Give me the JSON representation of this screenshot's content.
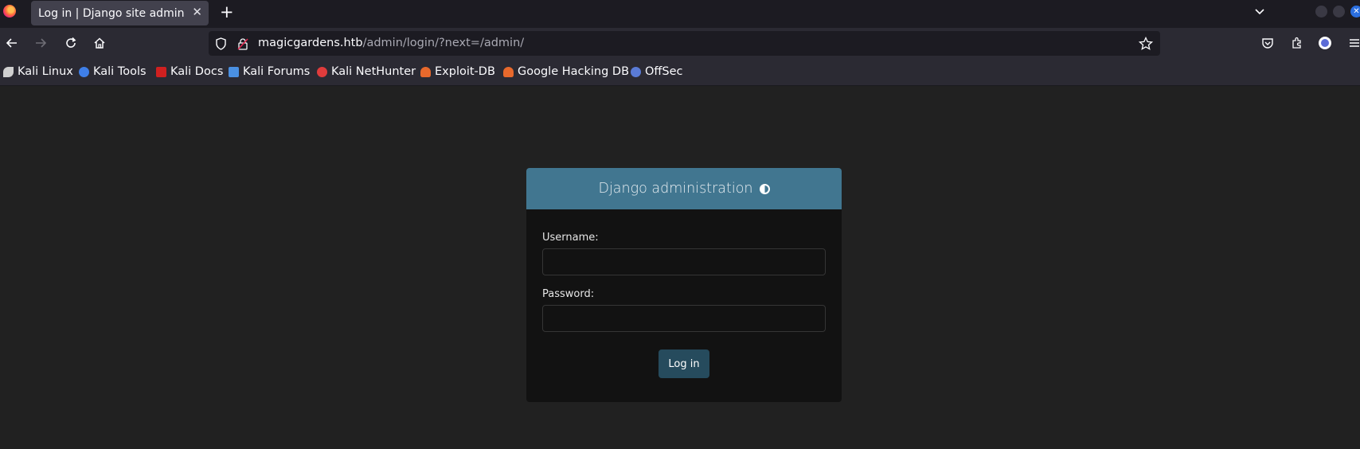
{
  "browser": {
    "tab": {
      "title": "Log in | Django site admin",
      "close_glyph": "✕"
    },
    "new_tab_glyph": "+",
    "tab_list_glyph": "⌄",
    "url": {
      "host": "magicgardens.htb",
      "path": "/admin/login/?next=/admin/"
    },
    "bookmarks": [
      {
        "label": "Kali Linux",
        "icon": "kali-dragon-icon",
        "color": "#d0d0d0"
      },
      {
        "label": "Kali Tools",
        "icon": "kali-tools-icon",
        "color": "#3f7fe8"
      },
      {
        "label": "Kali Docs",
        "icon": "kali-docs-icon",
        "color": "#d02020"
      },
      {
        "label": "Kali Forums",
        "icon": "kali-forums-icon",
        "color": "#4a90e2"
      },
      {
        "label": "Kali NetHunter",
        "icon": "kali-nethunter-icon",
        "color": "#e03c3c"
      },
      {
        "label": "Exploit-DB",
        "icon": "exploit-db-icon",
        "color": "#e8692c"
      },
      {
        "label": "Google Hacking DB",
        "icon": "ghdb-icon",
        "color": "#e8692c"
      },
      {
        "label": "OffSec",
        "icon": "offsec-icon",
        "color": "#5a7bd6"
      }
    ]
  },
  "login": {
    "title": "Django administration",
    "username_label": "Username:",
    "password_label": "Password:",
    "username_value": "",
    "password_value": "",
    "submit_label": "Log in",
    "header_color": "#417690",
    "button_color": "#264b5d"
  }
}
